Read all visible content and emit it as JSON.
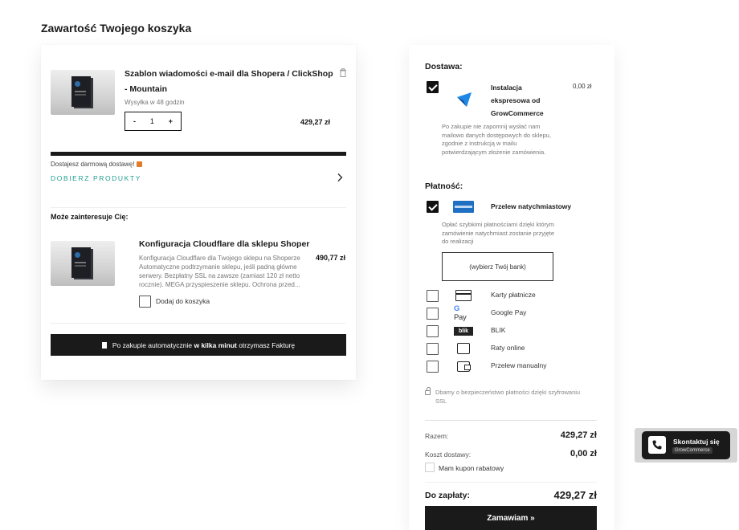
{
  "page": {
    "title": "Zawartość Twojego koszyka"
  },
  "cart": {
    "item": {
      "title": "Szablon wiadomości e-mail dla Shopera / ClickShop - Mountain",
      "shipping": "Wysyłka w 48 godzin",
      "qty_minus": "-",
      "quantity": "1",
      "qty_plus": "+",
      "price": "429,27 zł"
    },
    "free_shipping_text": "Dostajesz darmową dostawę!",
    "free_shipping_progress": 1,
    "pick_products_label": "DOBIERZ PRODUKTY",
    "maybe_title": "Może zainteresuje Cię:",
    "recommendation": {
      "title": "Konfiguracja Cloudflare dla sklepu Shoper",
      "price": "490,77 zł",
      "description": "Konfiguracja Cloudflare dla Twojego sklepu na Shoperze Automatyczne podtrzymanie sklepu, jeśli padną główne serwery. Bezpłatny SSL na zawsze (zamiast 120 zł netto rocznie). MEGA przyspieszenie sklepu. Ochrona przed...",
      "add_label": "Dodaj do koszyka"
    },
    "invoice": {
      "prefix": "Po zakupie automatycznie ",
      "bold": "w kilka minut",
      "suffix": " otrzymasz Fakturę"
    }
  },
  "delivery": {
    "heading": "Dostawa:",
    "option_name": "Instalacja ekspresowa od GrowCommerce",
    "option_price": "0,00 zł",
    "note": "Po zakupie nie zapomnij wysłać nam mailowo danych dostępowych do sklepu, zgodnie z instrukcją w mailu potwierdzającym złożenie zamówienia."
  },
  "payment": {
    "heading": "Płatność:",
    "selected": "Przelew natychmiastowy",
    "selected_note": "Opłać szybkimi płatnościami dzięki którym zamówienie natychmiast zostanie przyjęte do realizacji",
    "bank_select": "(wybierz Twój bank)",
    "methods": [
      {
        "label": "Karty płatnicze",
        "icon": "credit-card-icon"
      },
      {
        "label": "Google Pay",
        "icon": "google-pay-icon"
      },
      {
        "label": "BLIK",
        "icon": "blik-icon"
      },
      {
        "label": "Raty online",
        "icon": "installments-icon"
      },
      {
        "label": "Przelew manualny",
        "icon": "wallet-icon"
      }
    ],
    "gpay_logo_g": "G",
    "gpay_logo_text": " Pay",
    "blik_logo": "blik",
    "ssl_note": "Dbamy o bezpieczeństwo płatności dzięki szyfrowaniu SSL"
  },
  "summary": {
    "subtotal_label": "Razem:",
    "subtotal": "429,27 zł",
    "shipping_label": "Koszt dostawy:",
    "shipping": "0,00 zł",
    "coupon_label": "Mam kupon rabatowy",
    "total_label": "Do zapłaty:",
    "total": "429,27 zł",
    "order_button": "Zamawiam »"
  },
  "contact": {
    "title": "Skontaktuj się",
    "subtitle": "GrowCommerce"
  },
  "colors": {
    "accent": "#1f9e92",
    "dark": "#1a1a1a",
    "brand_blue": "#1f6fc2"
  }
}
